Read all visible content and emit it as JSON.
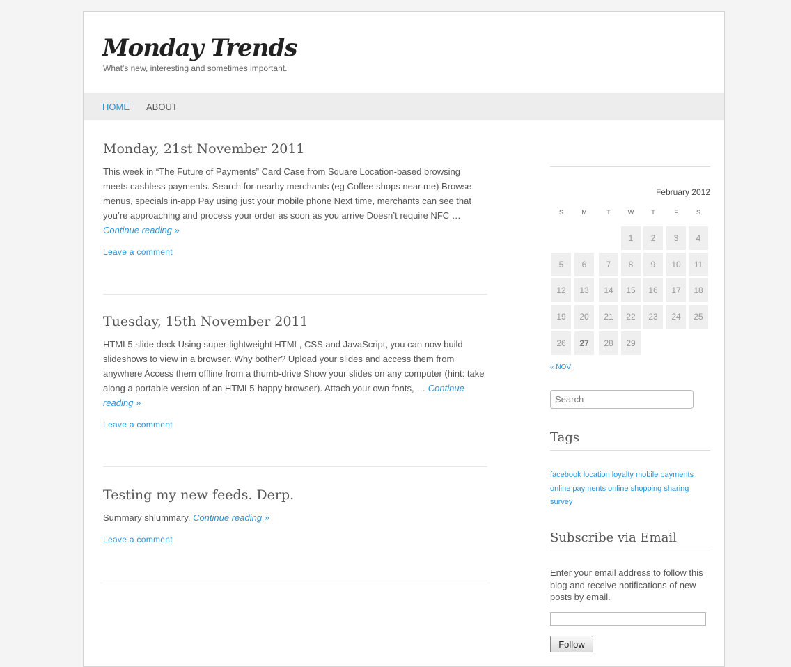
{
  "site": {
    "title": "Monday Trends",
    "tagline": "What's new, interesting and sometimes important."
  },
  "nav": {
    "home": "HOME",
    "about": "ABOUT"
  },
  "posts": [
    {
      "title": "Monday, 21st November 2011",
      "excerpt": "This week in “The Future of Payments” Card Case from Square Location-based browsing meets cashless payments. Search for nearby merchants (eg Coffee shops near me) Browse menus, specials in-app Pay using just your mobile phone Next time, merchants can see that you’re approaching and process your order as soon as you arrive Doesn’t require NFC … ",
      "continue": "Continue reading »",
      "comment": "Leave a comment"
    },
    {
      "title": "Tuesday, 15th November 2011",
      "excerpt": "HTML5 slide deck Using super-lightweight HTML, CSS and JavaScript, you can now build slideshows to view in a browser. Why bother? Upload your slides and access them from anywhere Access them offline from a thumb-drive Show your slides on any computer (hint: take along a portable version of an HTML5-happy browser). Attach your own fonts, … ",
      "continue": "Continue reading »",
      "comment": "Leave a comment"
    },
    {
      "title": "Testing my new feeds. Derp.",
      "excerpt": "Summary shlummary. ",
      "continue": "Continue reading »",
      "comment": "Leave a comment"
    }
  ],
  "calendar": {
    "caption": "February 2012",
    "weekdays": [
      "S",
      "M",
      "T",
      "W",
      "T",
      "F",
      "S"
    ],
    "days": [
      "1",
      "2",
      "3",
      "4",
      "5",
      "6",
      "7",
      "8",
      "9",
      "10",
      "11",
      "12",
      "13",
      "14",
      "15",
      "16",
      "17",
      "18",
      "19",
      "20",
      "21",
      "22",
      "23",
      "24",
      "25",
      "26",
      "27",
      "28",
      "29"
    ],
    "today": "27",
    "prev_link": "« NOV"
  },
  "search": {
    "placeholder": "Search"
  },
  "tags": {
    "title": "Tags",
    "items": [
      "facebook",
      "location",
      "loyalty",
      "mobile payments",
      "online payments",
      "online shopping",
      "sharing",
      "survey"
    ]
  },
  "subscribe": {
    "title": "Subscribe via Email",
    "description": "Enter your email address to follow this blog and receive notifications of new posts by email.",
    "email_value": "",
    "button": "Follow"
  },
  "colors": {
    "link": "#2a93d4",
    "text": "#555555",
    "nav_bg": "#ededed",
    "calendar_cell": "#efefef"
  }
}
